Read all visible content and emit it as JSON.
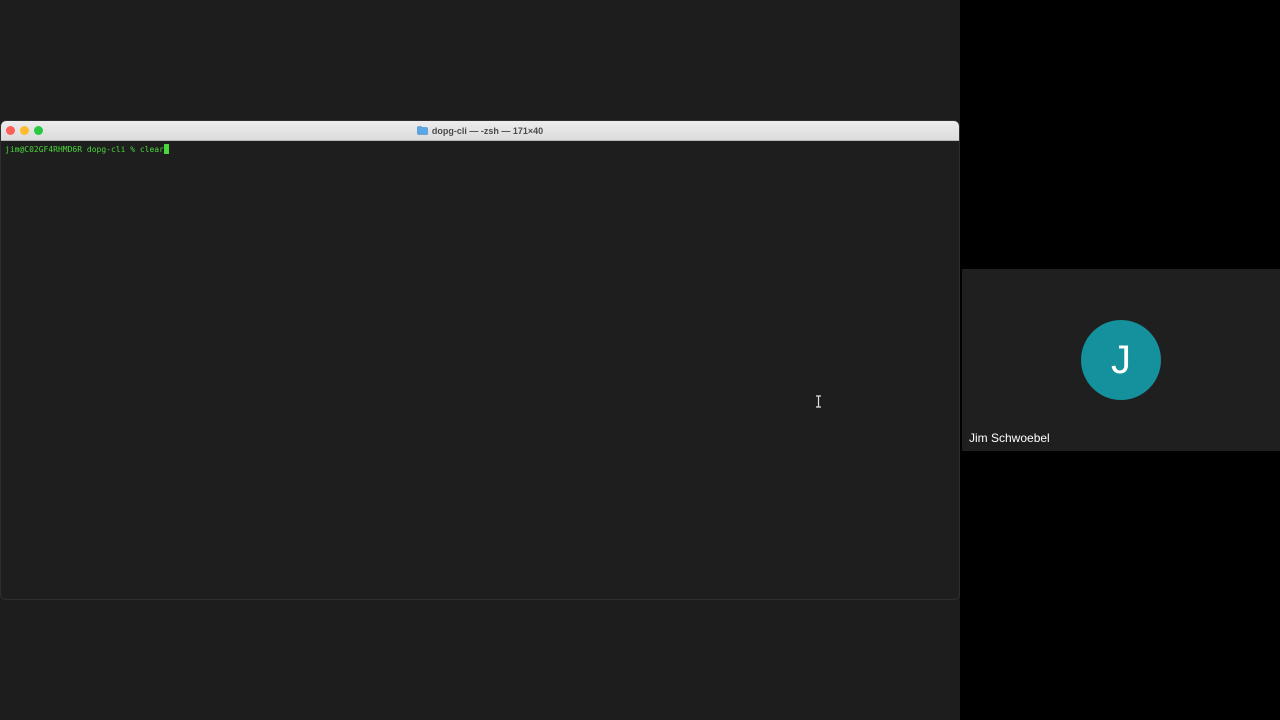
{
  "terminal": {
    "title": "dopg-cli — -zsh — 171×40",
    "prompt": "jim@C02GF4RHMD6R dopg-cli % ",
    "command": "clear"
  },
  "participant": {
    "initial": "J",
    "name": "Jim Schwoebel",
    "avatar_color": "#15909d"
  },
  "icons": {
    "folder": "folder-icon",
    "cursor": "text-ibeam-cursor-icon"
  }
}
